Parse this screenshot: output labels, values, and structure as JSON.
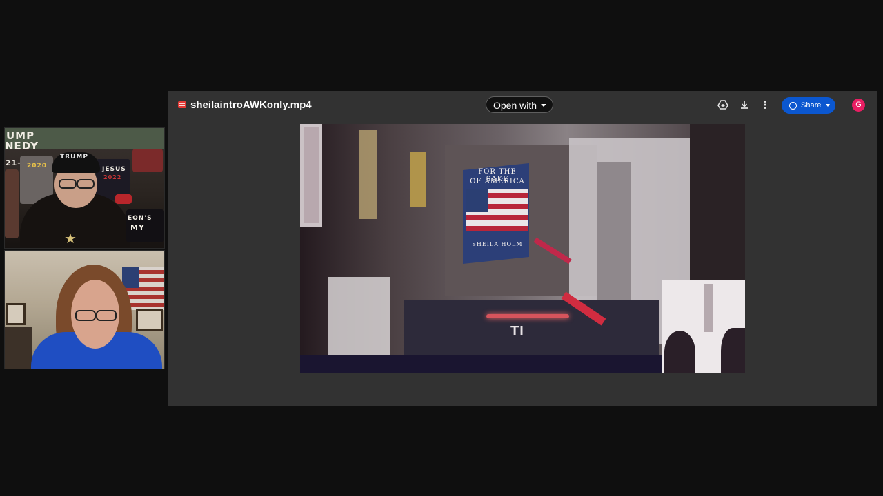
{
  "viewer": {
    "file_name": "sheilaintroAWKonly.mp4",
    "open_with_label": "Open with",
    "share_label": "Share",
    "avatar_initial": "G",
    "icons": [
      "add-to-drive-icon",
      "download-icon",
      "more-options-icon",
      "globe-icon"
    ]
  },
  "video": {
    "billboard_line1": "FOR THE SAKE",
    "billboard_line2": "OF AMERICA",
    "billboard_name": "SHEILA HOLM",
    "overlay_text": "TI"
  },
  "webcam_top": {
    "wall_text_1": "UMP",
    "wall_text_2": "NEDY",
    "wall_text_3": "21-",
    "shirt_text_1": "TRUMP",
    "shirt_text_2": "2020",
    "shirt_text_3": "JESUS",
    "shirt_text_4": "2022",
    "shirt_text_5": "EON'S",
    "shirt_text_6": "MY"
  },
  "colors": {
    "background": "#0f0f0f",
    "viewer_bg": "#323232",
    "share_blue": "#0b57d0",
    "avatar_pink": "#e91e63",
    "file_icon_red": "#e53935"
  }
}
